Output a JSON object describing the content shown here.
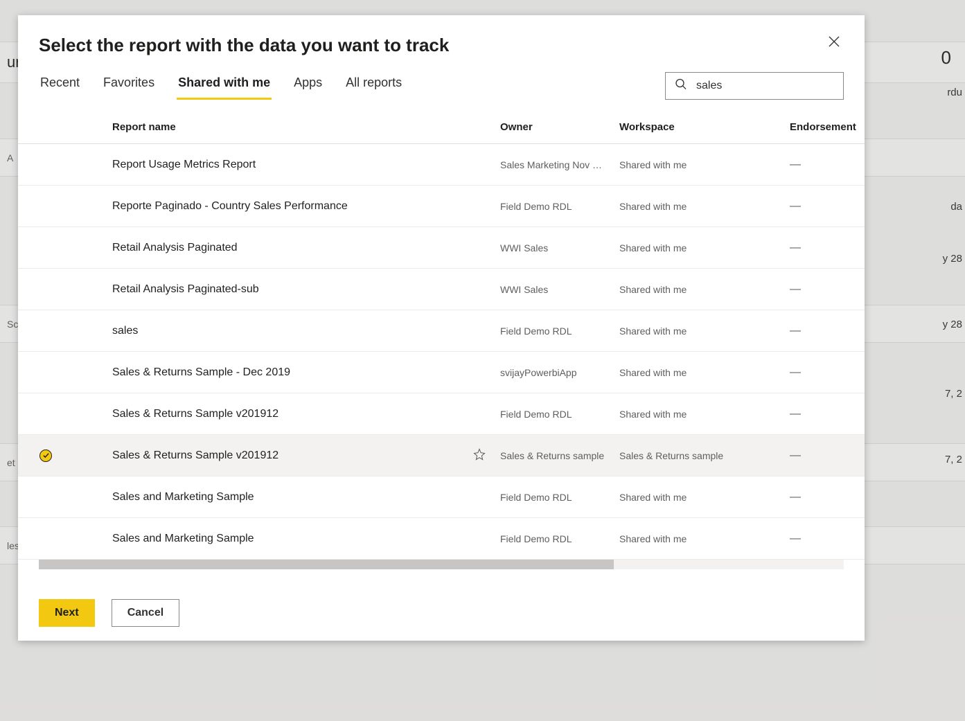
{
  "dialog": {
    "title": "Select the report with the data you want to track"
  },
  "tabs": [
    {
      "label": "Recent",
      "active": false
    },
    {
      "label": "Favorites",
      "active": false
    },
    {
      "label": "Shared with me",
      "active": true
    },
    {
      "label": "Apps",
      "active": false
    },
    {
      "label": "All reports",
      "active": false
    }
  ],
  "search": {
    "value": "sales"
  },
  "columns": {
    "report_name": "Report name",
    "owner": "Owner",
    "workspace": "Workspace",
    "endorsement": "Endorsement"
  },
  "rows": [
    {
      "selected": false,
      "name": "Report Usage Metrics Report",
      "owner": "Sales Marketing Nov …",
      "workspace": "Shared with me",
      "endorsement": "—"
    },
    {
      "selected": false,
      "name": "Reporte Paginado - Country Sales Performance",
      "owner": "Field Demo RDL",
      "workspace": "Shared with me",
      "endorsement": "—"
    },
    {
      "selected": false,
      "name": "Retail Analysis Paginated",
      "owner": "WWI Sales",
      "workspace": "Shared with me",
      "endorsement": "—"
    },
    {
      "selected": false,
      "name": "Retail Analysis Paginated-sub",
      "owner": "WWI Sales",
      "workspace": "Shared with me",
      "endorsement": "—"
    },
    {
      "selected": false,
      "name": "sales",
      "owner": "Field Demo RDL",
      "workspace": "Shared with me",
      "endorsement": "—"
    },
    {
      "selected": false,
      "name": "Sales & Returns Sample - Dec 2019",
      "owner": "svijayPowerbiApp",
      "workspace": "Shared with me",
      "endorsement": "—"
    },
    {
      "selected": false,
      "name": "Sales & Returns Sample v201912",
      "owner": "Field Demo RDL",
      "workspace": "Shared with me",
      "endorsement": "—"
    },
    {
      "selected": true,
      "name": "Sales & Returns Sample v201912",
      "owner": "Sales & Returns sample",
      "workspace": "Sales & Returns sample",
      "endorsement": "—",
      "show_favorite": true
    },
    {
      "selected": false,
      "name": "Sales and Marketing Sample",
      "owner": "Field Demo RDL",
      "workspace": "Shared with me",
      "endorsement": "—"
    },
    {
      "selected": false,
      "name": "Sales and Marketing Sample",
      "owner": "Field Demo RDL",
      "workspace": "Shared with me",
      "endorsement": "—"
    }
  ],
  "footer": {
    "next": "Next",
    "cancel": "Cancel"
  },
  "background": {
    "fragments": [
      "urr",
      "A",
      "Sc",
      "et S",
      "les",
      "0",
      "rdu",
      "da",
      "y 28",
      "y 28",
      "7, 2",
      "7, 2"
    ]
  }
}
